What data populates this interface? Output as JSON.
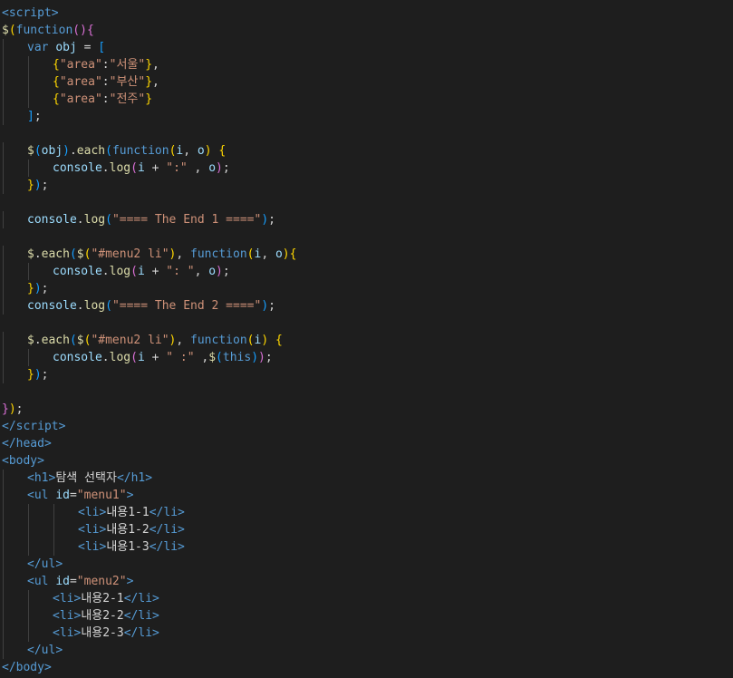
{
  "editor": {
    "theme_colors": {
      "background": "#1e1e1e",
      "tag": "#569cd6",
      "attribute": "#9cdcfe",
      "string": "#ce9178",
      "function": "#dcdcaa",
      "text": "#d4d4d4"
    },
    "partial_top_line": "",
    "partial_bottom_line": "",
    "lines": [
      {
        "indent": 0,
        "tokens": [
          {
            "t": "<",
            "c": "tag"
          },
          {
            "t": "script",
            "c": "tag"
          },
          {
            "t": ">",
            "c": "tag"
          }
        ]
      },
      {
        "indent": 0,
        "tokens": [
          {
            "t": "$",
            "c": "fn"
          },
          {
            "t": "(",
            "c": "brk1"
          },
          {
            "t": "function",
            "c": "kw"
          },
          {
            "t": "()",
            "c": "brk2"
          },
          {
            "t": "{",
            "c": "brk2"
          }
        ]
      },
      {
        "indent": 1,
        "tokens": [
          {
            "t": "var ",
            "c": "kw"
          },
          {
            "t": "obj",
            "c": "var"
          },
          {
            "t": " = ",
            "c": "p"
          },
          {
            "t": "[",
            "c": "brk3"
          }
        ]
      },
      {
        "indent": 2,
        "tokens": [
          {
            "t": "{",
            "c": "brk1"
          },
          {
            "t": "\"area\"",
            "c": "str"
          },
          {
            "t": ":",
            "c": "p"
          },
          {
            "t": "\"서울\"",
            "c": "str"
          },
          {
            "t": "}",
            "c": "brk1"
          },
          {
            "t": ",",
            "c": "p"
          }
        ]
      },
      {
        "indent": 2,
        "tokens": [
          {
            "t": "{",
            "c": "brk1"
          },
          {
            "t": "\"area\"",
            "c": "str"
          },
          {
            "t": ":",
            "c": "p"
          },
          {
            "t": "\"부산\"",
            "c": "str"
          },
          {
            "t": "}",
            "c": "brk1"
          },
          {
            "t": ",",
            "c": "p"
          }
        ]
      },
      {
        "indent": 2,
        "tokens": [
          {
            "t": "{",
            "c": "brk1"
          },
          {
            "t": "\"area\"",
            "c": "str"
          },
          {
            "t": ":",
            "c": "p"
          },
          {
            "t": "\"전주\"",
            "c": "str"
          },
          {
            "t": "}",
            "c": "brk1"
          }
        ]
      },
      {
        "indent": 1,
        "tokens": [
          {
            "t": "]",
            "c": "brk3"
          },
          {
            "t": ";",
            "c": "p"
          }
        ]
      },
      {
        "indent": 0,
        "tokens": []
      },
      {
        "indent": 1,
        "tokens": [
          {
            "t": "$",
            "c": "fn"
          },
          {
            "t": "(",
            "c": "brk3"
          },
          {
            "t": "obj",
            "c": "var"
          },
          {
            "t": ")",
            "c": "brk3"
          },
          {
            "t": ".",
            "c": "p"
          },
          {
            "t": "each",
            "c": "fn"
          },
          {
            "t": "(",
            "c": "brk3"
          },
          {
            "t": "function",
            "c": "kw"
          },
          {
            "t": "(",
            "c": "brk1"
          },
          {
            "t": "i",
            "c": "var"
          },
          {
            "t": ", ",
            "c": "p"
          },
          {
            "t": "o",
            "c": "var"
          },
          {
            "t": ")",
            "c": "brk1"
          },
          {
            "t": " ",
            "c": "p"
          },
          {
            "t": "{",
            "c": "brk1"
          }
        ]
      },
      {
        "indent": 2,
        "tokens": [
          {
            "t": "console",
            "c": "var"
          },
          {
            "t": ".",
            "c": "p"
          },
          {
            "t": "log",
            "c": "fn"
          },
          {
            "t": "(",
            "c": "brk2"
          },
          {
            "t": "i",
            "c": "var"
          },
          {
            "t": " + ",
            "c": "p"
          },
          {
            "t": "\":\"",
            "c": "str"
          },
          {
            "t": " , ",
            "c": "p"
          },
          {
            "t": "o",
            "c": "var"
          },
          {
            "t": ")",
            "c": "brk2"
          },
          {
            "t": ";",
            "c": "p"
          }
        ]
      },
      {
        "indent": 1,
        "tokens": [
          {
            "t": "}",
            "c": "brk1"
          },
          {
            "t": ")",
            "c": "brk3"
          },
          {
            "t": ";",
            "c": "p"
          }
        ]
      },
      {
        "indent": 0,
        "tokens": []
      },
      {
        "indent": 1,
        "tokens": [
          {
            "t": "console",
            "c": "var"
          },
          {
            "t": ".",
            "c": "p"
          },
          {
            "t": "log",
            "c": "fn"
          },
          {
            "t": "(",
            "c": "brk3"
          },
          {
            "t": "\"==== The End 1 ====\"",
            "c": "str"
          },
          {
            "t": ")",
            "c": "brk3"
          },
          {
            "t": ";",
            "c": "p"
          }
        ]
      },
      {
        "indent": 0,
        "tokens": []
      },
      {
        "indent": 1,
        "tokens": [
          {
            "t": "$",
            "c": "fn"
          },
          {
            "t": ".",
            "c": "p"
          },
          {
            "t": "each",
            "c": "fn"
          },
          {
            "t": "(",
            "c": "brk3"
          },
          {
            "t": "$",
            "c": "fn"
          },
          {
            "t": "(",
            "c": "brk1"
          },
          {
            "t": "\"#menu2 li\"",
            "c": "str"
          },
          {
            "t": ")",
            "c": "brk1"
          },
          {
            "t": ", ",
            "c": "p"
          },
          {
            "t": "function",
            "c": "kw"
          },
          {
            "t": "(",
            "c": "brk1"
          },
          {
            "t": "i",
            "c": "var"
          },
          {
            "t": ", ",
            "c": "p"
          },
          {
            "t": "o",
            "c": "var"
          },
          {
            "t": ")",
            "c": "brk1"
          },
          {
            "t": "{",
            "c": "brk1"
          }
        ]
      },
      {
        "indent": 2,
        "tokens": [
          {
            "t": "console",
            "c": "var"
          },
          {
            "t": ".",
            "c": "p"
          },
          {
            "t": "log",
            "c": "fn"
          },
          {
            "t": "(",
            "c": "brk2"
          },
          {
            "t": "i",
            "c": "var"
          },
          {
            "t": " + ",
            "c": "p"
          },
          {
            "t": "\": \"",
            "c": "str"
          },
          {
            "t": ", ",
            "c": "p"
          },
          {
            "t": "o",
            "c": "var"
          },
          {
            "t": ")",
            "c": "brk2"
          },
          {
            "t": ";",
            "c": "p"
          }
        ]
      },
      {
        "indent": 1,
        "tokens": [
          {
            "t": "}",
            "c": "brk1"
          },
          {
            "t": ")",
            "c": "brk3"
          },
          {
            "t": ";",
            "c": "p"
          }
        ]
      },
      {
        "indent": 1,
        "tokens": [
          {
            "t": "console",
            "c": "var"
          },
          {
            "t": ".",
            "c": "p"
          },
          {
            "t": "log",
            "c": "fn"
          },
          {
            "t": "(",
            "c": "brk3"
          },
          {
            "t": "\"==== The End 2 ====\"",
            "c": "str"
          },
          {
            "t": ")",
            "c": "brk3"
          },
          {
            "t": ";",
            "c": "p"
          }
        ]
      },
      {
        "indent": 0,
        "tokens": []
      },
      {
        "indent": 1,
        "tokens": [
          {
            "t": "$",
            "c": "fn"
          },
          {
            "t": ".",
            "c": "p"
          },
          {
            "t": "each",
            "c": "fn"
          },
          {
            "t": "(",
            "c": "brk3"
          },
          {
            "t": "$",
            "c": "fn"
          },
          {
            "t": "(",
            "c": "brk1"
          },
          {
            "t": "\"#menu2 li\"",
            "c": "str"
          },
          {
            "t": ")",
            "c": "brk1"
          },
          {
            "t": ", ",
            "c": "p"
          },
          {
            "t": "function",
            "c": "kw"
          },
          {
            "t": "(",
            "c": "brk1"
          },
          {
            "t": "i",
            "c": "var"
          },
          {
            "t": ")",
            "c": "brk1"
          },
          {
            "t": " ",
            "c": "p"
          },
          {
            "t": "{",
            "c": "brk1"
          }
        ]
      },
      {
        "indent": 2,
        "tokens": [
          {
            "t": "console",
            "c": "var"
          },
          {
            "t": ".",
            "c": "p"
          },
          {
            "t": "log",
            "c": "fn"
          },
          {
            "t": "(",
            "c": "brk2"
          },
          {
            "t": "i",
            "c": "var"
          },
          {
            "t": " + ",
            "c": "p"
          },
          {
            "t": "\" :\"",
            "c": "str"
          },
          {
            "t": " ,",
            "c": "p"
          },
          {
            "t": "$",
            "c": "fn"
          },
          {
            "t": "(",
            "c": "brk3"
          },
          {
            "t": "this",
            "c": "kw"
          },
          {
            "t": ")",
            "c": "brk3"
          },
          {
            "t": ")",
            "c": "brk2"
          },
          {
            "t": ";",
            "c": "p"
          }
        ]
      },
      {
        "indent": 1,
        "tokens": [
          {
            "t": "}",
            "c": "brk1"
          },
          {
            "t": ")",
            "c": "brk3"
          },
          {
            "t": ";",
            "c": "p"
          }
        ]
      },
      {
        "indent": 0,
        "tokens": []
      },
      {
        "indent": 0,
        "tokens": [
          {
            "t": "}",
            "c": "brk2"
          },
          {
            "t": ")",
            "c": "brk1"
          },
          {
            "t": ";",
            "c": "p"
          }
        ]
      },
      {
        "indent": 0,
        "tokens": [
          {
            "t": "</",
            "c": "tag"
          },
          {
            "t": "script",
            "c": "tag"
          },
          {
            "t": ">",
            "c": "tag"
          }
        ]
      },
      {
        "indent": 0,
        "tokens": [
          {
            "t": "</",
            "c": "tag"
          },
          {
            "t": "head",
            "c": "tag"
          },
          {
            "t": ">",
            "c": "tag"
          }
        ]
      },
      {
        "indent": 0,
        "tokens": [
          {
            "t": "<",
            "c": "tag"
          },
          {
            "t": "body",
            "c": "tag"
          },
          {
            "t": ">",
            "c": "tag"
          }
        ]
      },
      {
        "indent": 1,
        "tokens": [
          {
            "t": "<",
            "c": "tag"
          },
          {
            "t": "h1",
            "c": "tag"
          },
          {
            "t": ">",
            "c": "tag"
          },
          {
            "t": "탐색 선택자",
            "c": "p"
          },
          {
            "t": "</",
            "c": "tag"
          },
          {
            "t": "h1",
            "c": "tag"
          },
          {
            "t": ">",
            "c": "tag"
          }
        ]
      },
      {
        "indent": 1,
        "tokens": [
          {
            "t": "<",
            "c": "tag"
          },
          {
            "t": "ul",
            "c": "tag"
          },
          {
            "t": " ",
            "c": "p"
          },
          {
            "t": "id",
            "c": "attr"
          },
          {
            "t": "=",
            "c": "p"
          },
          {
            "t": "\"menu1\"",
            "c": "str"
          },
          {
            "t": ">",
            "c": "tag"
          }
        ]
      },
      {
        "indent": 3,
        "tokens": [
          {
            "t": "<",
            "c": "tag"
          },
          {
            "t": "li",
            "c": "tag"
          },
          {
            "t": ">",
            "c": "tag"
          },
          {
            "t": "내용1-1",
            "c": "p"
          },
          {
            "t": "</",
            "c": "tag"
          },
          {
            "t": "li",
            "c": "tag"
          },
          {
            "t": ">",
            "c": "tag"
          }
        ]
      },
      {
        "indent": 3,
        "tokens": [
          {
            "t": "<",
            "c": "tag"
          },
          {
            "t": "li",
            "c": "tag"
          },
          {
            "t": ">",
            "c": "tag"
          },
          {
            "t": "내용1-2",
            "c": "p"
          },
          {
            "t": "</",
            "c": "tag"
          },
          {
            "t": "li",
            "c": "tag"
          },
          {
            "t": ">",
            "c": "tag"
          }
        ]
      },
      {
        "indent": 3,
        "tokens": [
          {
            "t": "<",
            "c": "tag"
          },
          {
            "t": "li",
            "c": "tag"
          },
          {
            "t": ">",
            "c": "tag"
          },
          {
            "t": "내용1-3",
            "c": "p"
          },
          {
            "t": "</",
            "c": "tag"
          },
          {
            "t": "li",
            "c": "tag"
          },
          {
            "t": ">",
            "c": "tag"
          }
        ]
      },
      {
        "indent": 1,
        "tokens": [
          {
            "t": "</",
            "c": "tag"
          },
          {
            "t": "ul",
            "c": "tag"
          },
          {
            "t": ">",
            "c": "tag"
          }
        ]
      },
      {
        "indent": 1,
        "tokens": [
          {
            "t": "<",
            "c": "tag"
          },
          {
            "t": "ul",
            "c": "tag"
          },
          {
            "t": " ",
            "c": "p"
          },
          {
            "t": "id",
            "c": "attr"
          },
          {
            "t": "=",
            "c": "p"
          },
          {
            "t": "\"menu2\"",
            "c": "str"
          },
          {
            "t": ">",
            "c": "tag"
          }
        ]
      },
      {
        "indent": 2,
        "tokens": [
          {
            "t": "<",
            "c": "tag"
          },
          {
            "t": "li",
            "c": "tag"
          },
          {
            "t": ">",
            "c": "tag"
          },
          {
            "t": "내용2-1",
            "c": "p"
          },
          {
            "t": "</",
            "c": "tag"
          },
          {
            "t": "li",
            "c": "tag"
          },
          {
            "t": ">",
            "c": "tag"
          }
        ]
      },
      {
        "indent": 2,
        "tokens": [
          {
            "t": "<",
            "c": "tag"
          },
          {
            "t": "li",
            "c": "tag"
          },
          {
            "t": ">",
            "c": "tag"
          },
          {
            "t": "내용2-2",
            "c": "p"
          },
          {
            "t": "</",
            "c": "tag"
          },
          {
            "t": "li",
            "c": "tag"
          },
          {
            "t": ">",
            "c": "tag"
          }
        ]
      },
      {
        "indent": 2,
        "tokens": [
          {
            "t": "<",
            "c": "tag"
          },
          {
            "t": "li",
            "c": "tag"
          },
          {
            "t": ">",
            "c": "tag"
          },
          {
            "t": "내용2-3",
            "c": "p"
          },
          {
            "t": "</",
            "c": "tag"
          },
          {
            "t": "li",
            "c": "tag"
          },
          {
            "t": ">",
            "c": "tag"
          }
        ]
      },
      {
        "indent": 1,
        "tokens": [
          {
            "t": "</",
            "c": "tag"
          },
          {
            "t": "ul",
            "c": "tag"
          },
          {
            "t": ">",
            "c": "tag"
          }
        ]
      },
      {
        "indent": 0,
        "tokens": [
          {
            "t": "</",
            "c": "tag"
          },
          {
            "t": "body",
            "c": "tag"
          },
          {
            "t": ">",
            "c": "tag"
          }
        ]
      }
    ]
  }
}
